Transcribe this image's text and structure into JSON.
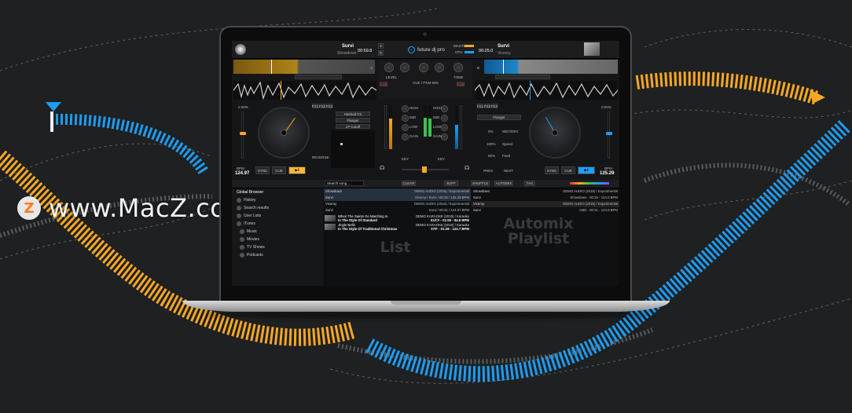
{
  "watermark": {
    "logo_letter": "Z",
    "text": "www.MacZ.com"
  },
  "app": {
    "name": "future dj pro",
    "logo_glyph": "◐",
    "deck_left": {
      "title": "Survi",
      "artist": "Showdown",
      "time": "00:59.8",
      "pitch_percent": "0.00%",
      "bpm_label": "BPM",
      "bpm": "124.97",
      "buttons": {
        "sync": "SYNC",
        "cue": "CUE",
        "play": "▶‖"
      },
      "label_a": "A",
      "fx_buttons": [
        "FX1",
        "FX2",
        "FX3"
      ],
      "fx_list": [
        "Hashed FX",
        "Flanger",
        "LP Cutoff"
      ],
      "reverse": "REVERSE"
    },
    "deck_right": {
      "title": "Survi",
      "artist": "Viceroy",
      "time": "00:25.0",
      "pitch_percent": "0.00%",
      "bpm_label": "BPM",
      "bpm": "125.29",
      "buttons": {
        "sync": "SYNC",
        "cue": "CUE",
        "play": "▶‖"
      },
      "label_b": "B",
      "fx_buttons": [
        "FX1",
        "FX2",
        "FX3"
      ],
      "fx_list": [
        "Flanger"
      ],
      "fx_params": {
        "a_val": "0%",
        "a_label": "WET/DRY",
        "b_val": "100%",
        "b_label": "Speed",
        "c_val": "50%",
        "c_label": "Feed"
      },
      "prev": "PREV",
      "next": "NEXT"
    },
    "mixer": {
      "master_label": "MASTER",
      "cpu_label": "CPU",
      "level": "LEVEL",
      "cue_mix": "CUE / PGM MIX",
      "tone": "TONE",
      "cue_labels": [
        "CUE",
        "CUE"
      ],
      "eq_labels": [
        "LOW",
        "MID",
        "HIGH",
        "GAIN",
        "HIGH",
        "MID",
        "LOW",
        "GAIN"
      ],
      "key": "KEY",
      "crossfader_label": "XFADE"
    },
    "browser": {
      "search_placeholder": "Search song ...",
      "toolbar": {
        "clear": "CLEAR",
        "suff": "SUFF",
        "shuffle": "SHUFFLE",
        "automix": "AUTOMIX",
        "tag": "TAG"
      },
      "tree": [
        "Global Browser",
        "History",
        "Search results",
        "User Lists",
        "iTunes",
        "Music",
        "Movies",
        "TV Shows",
        "Podcasts"
      ],
      "tracks": [
        {
          "left": "Showdown",
          "right": "DEMO AUDIO (2015) / Experimental",
          "sel": true
        },
        {
          "left": "Survi",
          "right": "Viceroy / Survi / 00:25 / 125.29 BPM",
          "sel": true
        },
        {
          "left": "Viceroy",
          "right": "DEMO AUDIO (2015) / Experimental",
          "sel": false
        },
        {
          "left": "Survi",
          "right": "Survi / 00:31 / 124.97 BPM",
          "sel": false
        }
      ],
      "tracks2": [
        {
          "t1": "When The Saints Go Marching In",
          "t2": "In The Style Of Standard",
          "r1": "DEMO KARAOKE (2015) / Karaoke",
          "r2": "01/C# - 01:06 - 94.8 BPM"
        },
        {
          "t1": "Jingle Bells",
          "t2": "In The Style Of Traditional Christmas",
          "r1": "DEMO KARAOKE (2015) / Karaoke",
          "r2": "07/F - 01:28 - 123.7 BPM"
        }
      ],
      "automix_tracks": [
        {
          "left": "Showdown",
          "right": "DEMO AUDIO (2015) / Experimental"
        },
        {
          "left": "Survi",
          "right": "Showdown - 00:25 - 124.0 BPM"
        },
        {
          "left": "Viceroy",
          "right": "DEMO AUDIO (2015) / Experimental"
        },
        {
          "left": "Survi",
          "right": "AMD - 00:31 - 124.9 BPM"
        }
      ],
      "list_watermark": "List",
      "automix_watermark": [
        "Automix",
        "Playlist"
      ]
    }
  },
  "colors": {
    "orange": "#f7a823",
    "blue": "#1e9cf0",
    "background": "#1f2022"
  }
}
